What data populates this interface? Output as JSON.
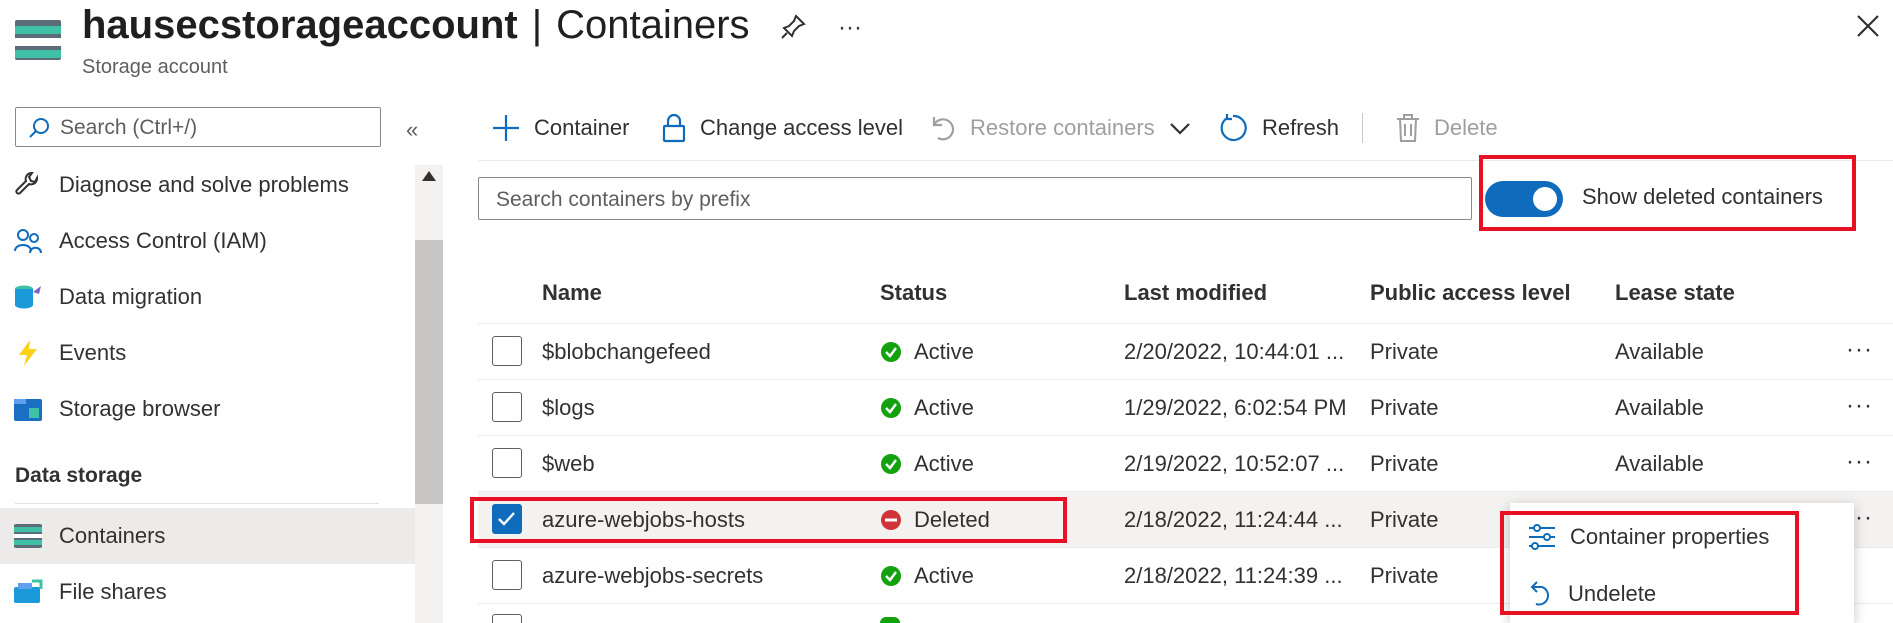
{
  "header": {
    "resource_name": "hausecstorageaccount",
    "separator": "|",
    "page_name": "Containers",
    "subtitle": "Storage account",
    "icons": [
      "storage-account-icon",
      "pin-icon",
      "more-icon",
      "close-icon"
    ]
  },
  "sidebar": {
    "search_placeholder": "Search (Ctrl+/)",
    "items": [
      {
        "label": "Diagnose and solve problems",
        "icon": "wrench-icon"
      },
      {
        "label": "Access Control (IAM)",
        "icon": "people-icon"
      },
      {
        "label": "Data migration",
        "icon": "data-migration-icon"
      },
      {
        "label": "Events",
        "icon": "lightning-icon"
      },
      {
        "label": "Storage browser",
        "icon": "storage-browser-icon"
      }
    ],
    "section": "Data storage",
    "section_items": [
      {
        "label": "Containers",
        "icon": "containers-icon",
        "active": true
      },
      {
        "label": "File shares",
        "icon": "file-shares-icon"
      }
    ]
  },
  "toolbar": {
    "container": "Container",
    "change_access": "Change access level",
    "restore": "Restore containers",
    "refresh": "Refresh",
    "delete": "Delete"
  },
  "filter": {
    "placeholder": "Search containers by prefix",
    "toggle_label": "Show deleted containers",
    "toggle_on": true
  },
  "table": {
    "columns": [
      "Name",
      "Status",
      "Last modified",
      "Public access level",
      "Lease state"
    ],
    "rows": [
      {
        "name": "$blobchangefeed",
        "status": "Active",
        "modified": "2/20/2022, 10:44:01 ...",
        "access": "Private",
        "lease": "Available",
        "checked": false
      },
      {
        "name": "$logs",
        "status": "Active",
        "modified": "1/29/2022, 6:02:54 PM",
        "access": "Private",
        "lease": "Available",
        "checked": false
      },
      {
        "name": "$web",
        "status": "Active",
        "modified": "2/19/2022, 10:52:07 ...",
        "access": "Private",
        "lease": "Available",
        "checked": false
      },
      {
        "name": "azure-webjobs-hosts",
        "status": "Deleted",
        "modified": "2/18/2022, 11:24:44 ...",
        "access": "Private",
        "lease": "",
        "checked": true
      },
      {
        "name": "azure-webjobs-secrets",
        "status": "Active",
        "modified": "2/18/2022, 11:24:39 ...",
        "access": "Private",
        "lease": "",
        "checked": false
      }
    ]
  },
  "context_menu": {
    "items": [
      "Container properties",
      "Undelete"
    ]
  },
  "colors": {
    "accent": "#0f6cbd",
    "active_status": "#13a10e",
    "deleted_status": "#d13438",
    "highlight": "#e81123"
  }
}
